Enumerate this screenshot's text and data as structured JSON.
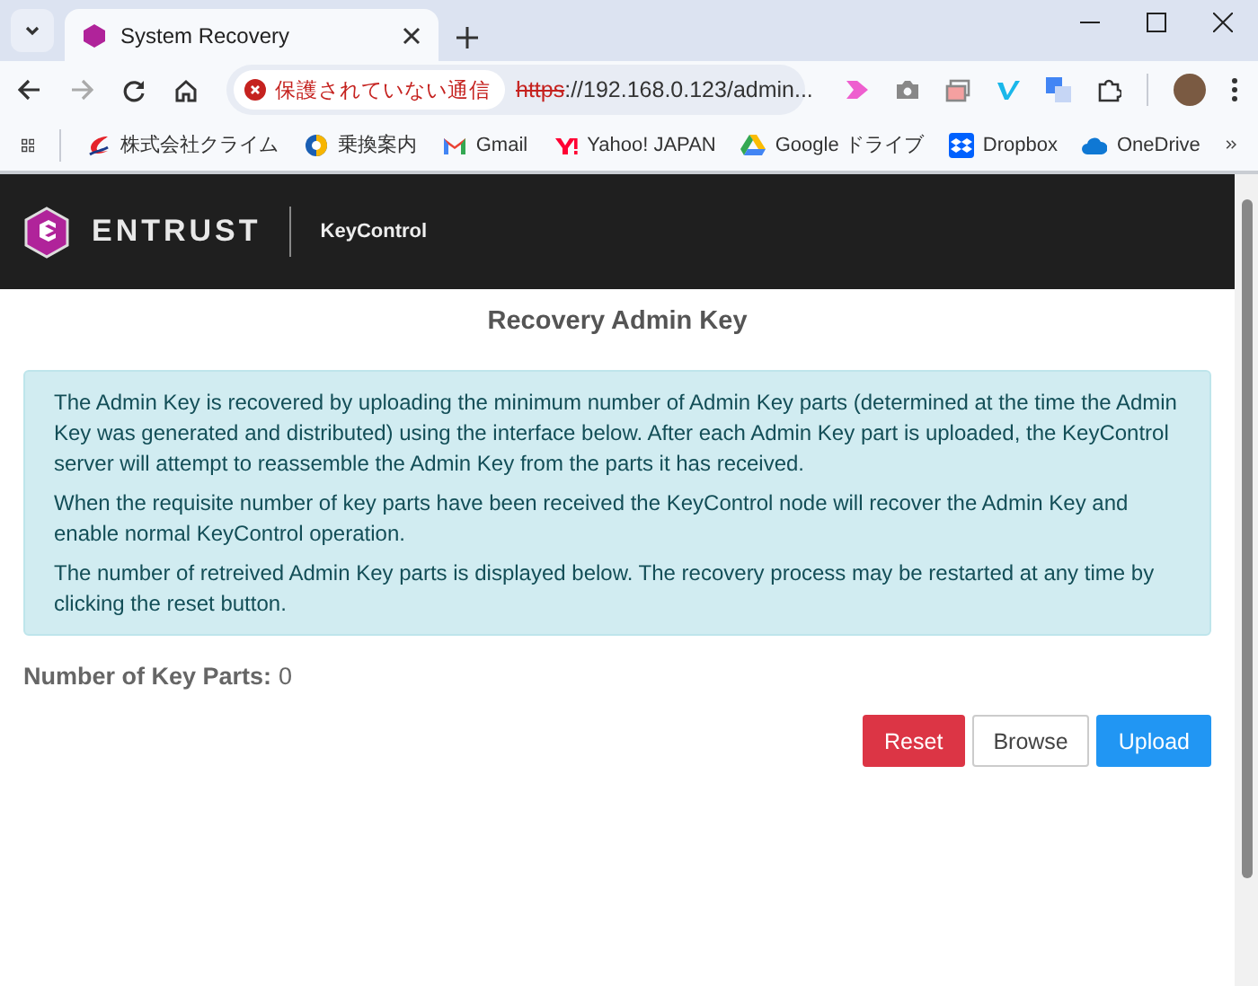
{
  "browser": {
    "tab": {
      "title": "System Recovery",
      "selected": true
    },
    "address": {
      "warning": "保護されていない通信",
      "scheme": "https",
      "rest": "://192.168.0.123/admin..."
    },
    "bookmarks": [
      {
        "label": "株式会社クライム",
        "kind": "swoosh"
      },
      {
        "label": "乗換案内",
        "kind": "transit"
      },
      {
        "label": "Gmail",
        "kind": "mail"
      },
      {
        "label": "Yahoo! JAPAN",
        "kind": "yahoo"
      },
      {
        "label": "Google ドライブ",
        "kind": "drive"
      },
      {
        "label": "Dropbox",
        "kind": "dropbox"
      },
      {
        "label": "OneDrive",
        "kind": "cloud"
      }
    ]
  },
  "header": {
    "brand": "ENTRUST",
    "product": "KeyControl"
  },
  "page": {
    "title": "Recovery Admin Key",
    "info": [
      "The Admin Key is recovered by uploading the minimum number of Admin Key parts (determined at the time the Admin Key was generated and distributed) using the interface below. After each Admin Key part is uploaded, the KeyControl server will attempt to reassemble the Admin Key from the parts it has received.",
      "When the requisite number of key parts have been received the KeyControl node will recover the Admin Key and enable normal KeyControl operation.",
      "The number of retreived Admin Key parts is displayed below. The recovery process may be restarted at any time by clicking the reset button."
    ],
    "count": {
      "label": "Number of Key Parts:",
      "value": "0"
    },
    "buttons": [
      {
        "label": "Reset",
        "kind": "danger"
      },
      {
        "label": "Browse",
        "kind": "plain"
      },
      {
        "label": "Upload",
        "kind": "primary"
      }
    ]
  }
}
